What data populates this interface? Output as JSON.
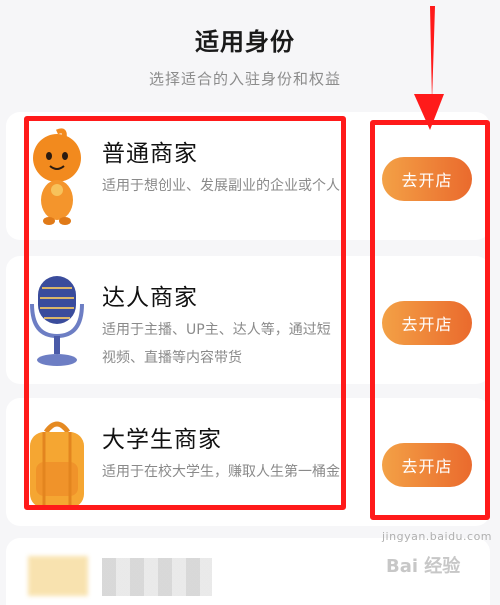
{
  "header": {
    "title": "适用身份",
    "subtitle": "选择适合的入驻身份和权益"
  },
  "cards": [
    {
      "name": "普通商家",
      "description": "适用于想创业、发展副业的企业或个人",
      "button_label": "去开店",
      "icon": "mascot-icon"
    },
    {
      "name": "达人商家",
      "description": "适用于主播、UP主、达人等，通过短视频、直播等内容带货",
      "button_label": "去开店",
      "icon": "microphone-icon"
    },
    {
      "name": "大学生商家",
      "description": "适用于在校大学生，赚取人生第一桶金",
      "button_label": "去开店",
      "icon": "backpack-icon"
    }
  ],
  "watermark": {
    "text": "Bai 经验",
    "url": "jingyan.baidu.com"
  },
  "colors": {
    "button_start": "#f3a146",
    "button_end": "#ea6a2d",
    "annotation": "#ff1a1a",
    "background": "#f6f6f8"
  }
}
